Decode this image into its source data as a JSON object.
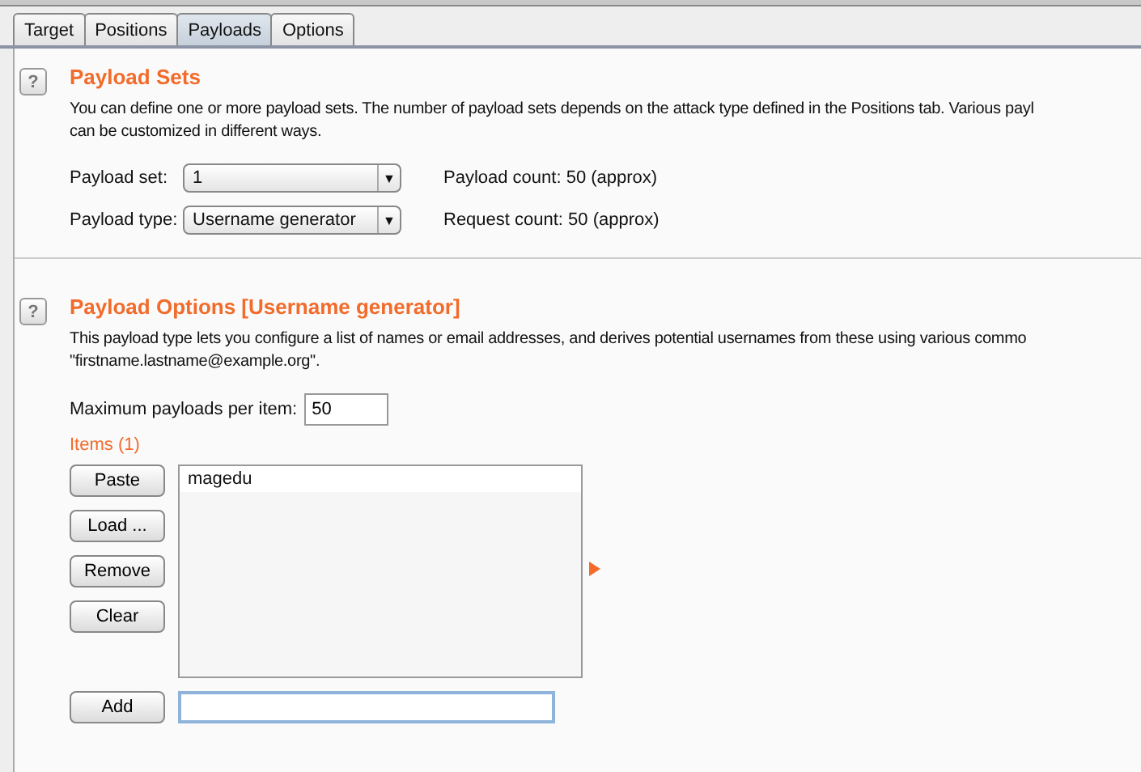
{
  "tabs": [
    {
      "label": "Target",
      "selected": false
    },
    {
      "label": "Positions",
      "selected": false
    },
    {
      "label": "Payloads",
      "selected": true
    },
    {
      "label": "Options",
      "selected": false
    }
  ],
  "payload_sets": {
    "help": "?",
    "title": "Payload Sets",
    "description": "You can define one or more payload sets. The number of payload sets depends on the attack type defined in the Positions tab. Various payl",
    "description_2": "can be customized in different ways.",
    "payload_set": {
      "label": "Payload set:",
      "value": "1",
      "caret": "▼"
    },
    "payload_type": {
      "label": "Payload type:",
      "value": "Username generator",
      "caret": "▼"
    },
    "payload_count": "Payload count:  50 (approx)",
    "request_count": "Request count:  50 (approx)"
  },
  "payload_options": {
    "help": "?",
    "title": "Payload Options [Username generator]",
    "description": "This payload type lets you configure a list of names or email addresses, and derives potential usernames from these using various commo",
    "description_2": "\"firstname.lastname@example.org\".",
    "max_payloads": {
      "label": "Maximum payloads per item:",
      "value": "50"
    },
    "items_label": "Items (1)",
    "buttons": [
      "Paste",
      "Load ...",
      "Remove",
      "Clear"
    ],
    "items": [
      "magedu"
    ],
    "add_button": "Add"
  }
}
